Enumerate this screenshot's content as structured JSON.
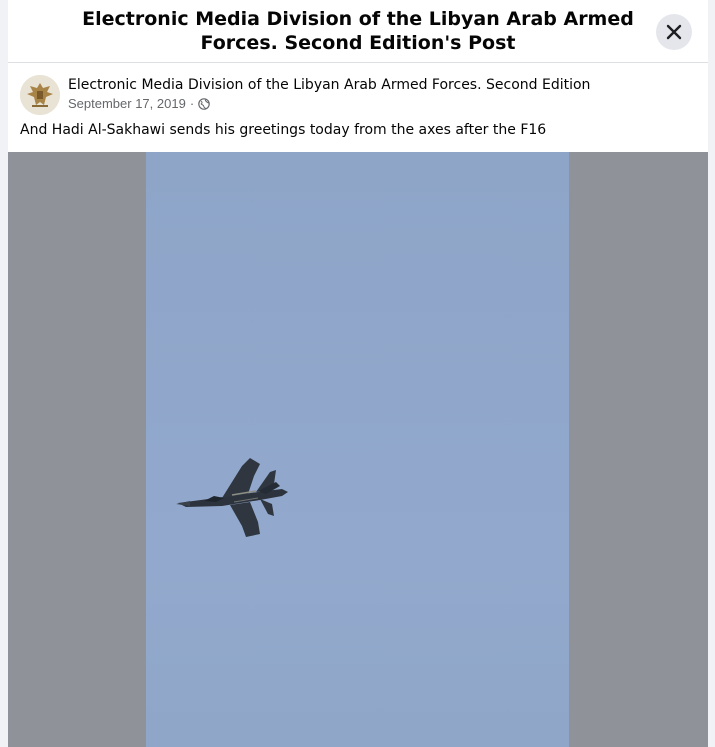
{
  "dialog": {
    "title": "Electronic Media Division of the Libyan Arab Armed Forces. Second Edition's Post",
    "close_icon": "close-icon"
  },
  "post": {
    "author": "Electronic Media Division of the Libyan Arab Armed Forces. Second Edition",
    "date": "September 17, 2019",
    "separator": "·",
    "privacy_icon": "globe-icon",
    "text": "And Hadi Al-Sakhawi sends his greetings today from the axes after the F16"
  },
  "colors": {
    "sky": "#8fa6c8",
    "letterbox": "#8f9298",
    "jet": "#2c333d"
  }
}
